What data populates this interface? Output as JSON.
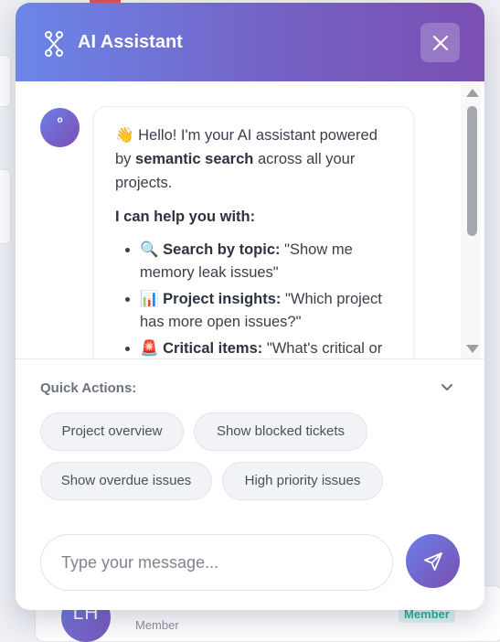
{
  "panel": {
    "title": "AI Assistant",
    "header_icon": "network-icon",
    "close_icon": "close-icon"
  },
  "message": {
    "avatar_text": "o",
    "greeting_emoji": "👋",
    "intro_pre": "Hello! I'm your AI assistant powered by",
    "intro_bold": "semantic search",
    "intro_post": "across all your projects.",
    "help_heading": "I can help you with:",
    "items": [
      {
        "emoji": "🔍",
        "label": "Search by topic:",
        "text": "\"Show me memory leak issues\""
      },
      {
        "emoji": "📊",
        "label": "Project insights:",
        "text": "\"Which project has more open issues?\""
      },
      {
        "emoji": "🚨",
        "label": "Critical items:",
        "text": "\"What's critical or"
      }
    ]
  },
  "quick_actions": {
    "title": "Quick Actions:",
    "toggle_icon": "chevron-down-icon",
    "chips": [
      "Project overview",
      "Show blocked tickets",
      "Show overdue issues",
      "High priority issues"
    ]
  },
  "composer": {
    "placeholder": "Type your message...",
    "send_icon": "send-icon"
  },
  "background": {
    "avatar_initials": "LH",
    "role": "Member",
    "badge": "Member"
  },
  "colors": {
    "gradient_start": "#6b86e8",
    "gradient_end": "#7a4fb2",
    "badge_text": "#2bb09b"
  }
}
